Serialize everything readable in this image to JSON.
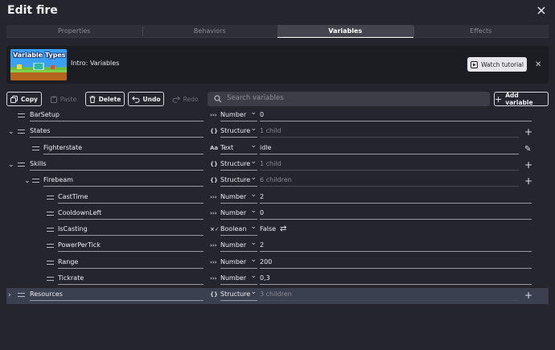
{
  "header": {
    "title": "Edit fire"
  },
  "tabs": [
    {
      "label": "Properties",
      "active": false
    },
    {
      "label": "Behaviors",
      "active": false
    },
    {
      "label": "Variables",
      "active": true
    },
    {
      "label": "Effects",
      "active": false
    }
  ],
  "tutorial": {
    "thumbnail_text": "Variable Types",
    "title": "Intro: Variables",
    "watch_label": "Watch tutorial"
  },
  "toolbar": {
    "copy": "Copy",
    "paste": "Paste",
    "delete": "Delete",
    "undo": "Undo",
    "redo": "Redo",
    "search_placeholder": "Search variables",
    "add": "Add variable"
  },
  "variables": [
    {
      "name": "BarSetup",
      "type": "Number",
      "value": "0",
      "level": 0,
      "expander": "",
      "action": "",
      "type_icon": "number-icon"
    },
    {
      "name": "States",
      "type": "Structure",
      "value": "1 child",
      "level": 0,
      "expander": "expanded",
      "action": "add",
      "type_icon": "structure-icon"
    },
    {
      "name": "Fighterstate",
      "type": "Text",
      "value": "idle",
      "level": 1,
      "expander": "",
      "action": "edit",
      "type_icon": "text-icon"
    },
    {
      "name": "Skills",
      "type": "Structure",
      "value": "1 child",
      "level": 0,
      "expander": "expanded",
      "action": "add",
      "type_icon": "structure-icon"
    },
    {
      "name": "Firebeam",
      "type": "Structure",
      "value": "6 children",
      "level": 1,
      "expander": "expanded",
      "action": "add",
      "type_icon": "structure-icon"
    },
    {
      "name": "CastTime",
      "type": "Number",
      "value": "2",
      "level": 2,
      "expander": "",
      "action": "",
      "type_icon": "number-icon"
    },
    {
      "name": "CooldownLeft",
      "type": "Number",
      "value": "0",
      "level": 2,
      "expander": "",
      "action": "",
      "type_icon": "number-icon"
    },
    {
      "name": "IsCasting",
      "type": "Boolean",
      "value": "False",
      "level": 2,
      "expander": "",
      "action": "",
      "type_icon": "boolean-icon"
    },
    {
      "name": "PowerPerTick",
      "type": "Number",
      "value": "2",
      "level": 2,
      "expander": "",
      "action": "",
      "type_icon": "number-icon"
    },
    {
      "name": "Range",
      "type": "Number",
      "value": "200",
      "level": 2,
      "expander": "",
      "action": "",
      "type_icon": "number-icon"
    },
    {
      "name": "Tickrate",
      "type": "Number",
      "value": "0,3",
      "level": 2,
      "expander": "",
      "action": "",
      "type_icon": "number-icon"
    },
    {
      "name": "Resources",
      "type": "Structure",
      "value": "3 children",
      "level": 0,
      "expander": "collapsed",
      "action": "add",
      "type_icon": "structure-icon",
      "selected": true
    }
  ]
}
